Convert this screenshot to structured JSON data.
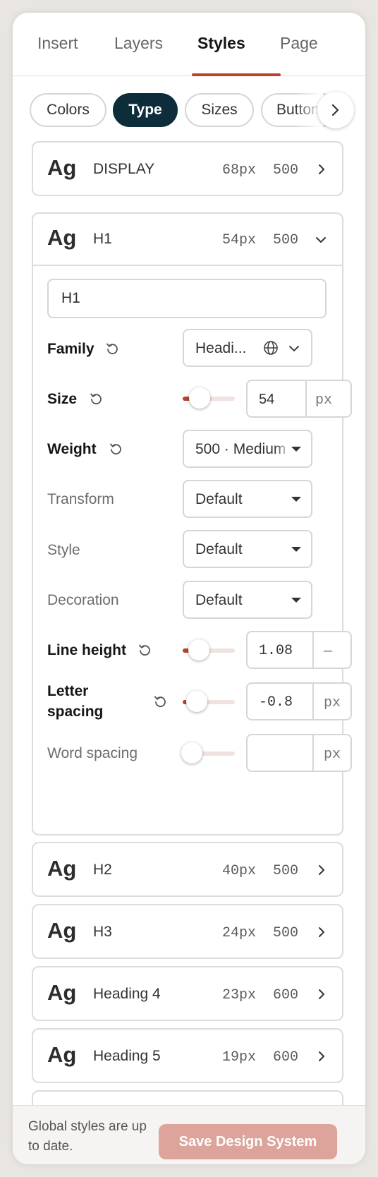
{
  "tabs": [
    {
      "label": "Insert",
      "active": false
    },
    {
      "label": "Layers",
      "active": false
    },
    {
      "label": "Styles",
      "active": true
    },
    {
      "label": "Page",
      "active": false
    }
  ],
  "chips": [
    {
      "label": "Colors",
      "active": false
    },
    {
      "label": "Type",
      "active": true
    },
    {
      "label": "Sizes",
      "active": false
    },
    {
      "label": "Buttons",
      "active": false
    }
  ],
  "type_styles": [
    {
      "sample": "Ag",
      "name": "DISPLAY",
      "size": "68px",
      "weight": "500",
      "expanded": false
    },
    {
      "sample": "Ag",
      "name": "H1",
      "size": "54px",
      "weight": "500",
      "expanded": true
    },
    {
      "sample": "Ag",
      "name": "H2",
      "size": "40px",
      "weight": "500",
      "expanded": false
    },
    {
      "sample": "Ag",
      "name": "H3",
      "size": "24px",
      "weight": "500",
      "expanded": false
    },
    {
      "sample": "Ag",
      "name": "Heading 4",
      "size": "23px",
      "weight": "600",
      "expanded": false
    },
    {
      "sample": "Ag",
      "name": "Heading 5",
      "size": "19px",
      "weight": "600",
      "expanded": false
    }
  ],
  "editor": {
    "name_value": "H1",
    "family": {
      "label": "Family",
      "value": "Headi..."
    },
    "size": {
      "label": "Size",
      "value": "54",
      "unit": "px",
      "slider_fraction": 0.18
    },
    "weight": {
      "label": "Weight",
      "value": "500 · Medium"
    },
    "transform": {
      "label": "Transform",
      "value": "Default"
    },
    "style": {
      "label": "Style",
      "value": "Default"
    },
    "decoration": {
      "label": "Decoration",
      "value": "Default"
    },
    "line_height": {
      "label": "Line height",
      "value": "1.08",
      "unit": "—",
      "slider_fraction": 0.16
    },
    "letter_spacing": {
      "label_line1": "Letter",
      "label_line2": "spacing",
      "value": "-0.8",
      "unit": "px",
      "slider_fraction": 0.12
    },
    "word_spacing": {
      "label": "Word spacing",
      "value": "",
      "unit": "px",
      "slider_fraction": 0.0
    }
  },
  "footer": {
    "status": "Global styles are up to date.",
    "save_label": "Save Design System"
  },
  "colors": {
    "accent": "#b8422c",
    "active_chip": "#0d2d3a",
    "save_button": "#dca49b"
  }
}
